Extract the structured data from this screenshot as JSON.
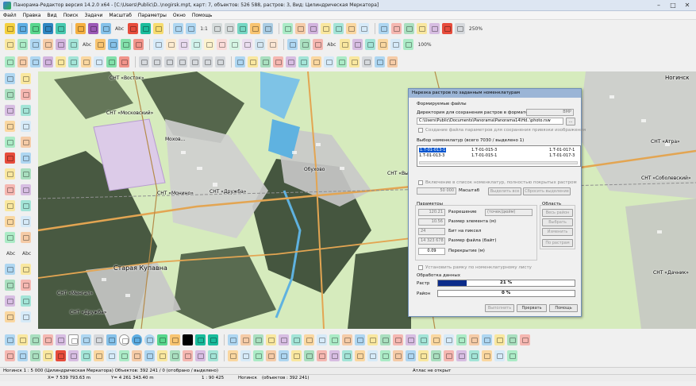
{
  "window": {
    "title": "Панорама-Редактор версия 14.2.0 x64 - [C:\\Users\\Public\\D..\\nogirsk.mpt, карт: 7, объектов: 526 588, растров: 3, Вид: Цилиндрическая Меркатора]",
    "minimize": "–",
    "maximize": "□",
    "close": "✕"
  },
  "menu": [
    "Файл",
    "Правка",
    "Вид",
    "Поиск",
    "Задачи",
    "Масштаб",
    "Параметры",
    "Окно",
    "Помощь"
  ],
  "toolbar": {
    "zoom_label": "1:1",
    "zoom_percent": "250%",
    "zoom_100": "100%",
    "abc_label": "Abc"
  },
  "map": {
    "labels": {
      "snt_vostok": "СНТ «Восток»",
      "snt_moskovskiy": "СНТ «Московский»",
      "mokhovoe": "Мохов...",
      "obukhovo": "Обухово",
      "snt_druzhba": "СНТ «Дружба»",
      "snt_monino": "СНТ «Монино»",
      "staraya_kupavna": "Старая Купавна",
      "noginsk": "Ногинск",
      "snt_mengal": "СНТ «Менгал»",
      "snt_druzhba2": "СНТ «Дружба»",
      "snt_vyserk": "СНТ «Выселки»",
      "snt_atra": "СНТ «Атра»",
      "snt_sobolevskiy": "СНТ «Соболевский»",
      "snt_dachnik": "СНТ «Дачник»"
    }
  },
  "dialog": {
    "title": "Нарезка растров по заданным номенклатурам",
    "section_form": "Формируемые файлы",
    "dir_label": "Директория для сохранения растров в формате",
    "format_value": "BMP",
    "path_value": "C:\\Users\\Public\\Documents\\Panorama\\Panorama14\\Hd..\\photo.rsw",
    "browse_btn": "...",
    "create_param_label": "Создание файла параметров для сохранения привязки изображения",
    "nom_select_label": "Выбор номенклатур (всего 7030 / выделено 1)",
    "nomenclatures": [
      [
        "1.Т-01-013-1",
        "1.Т-01-015-3",
        "1.Т-01-017-1"
      ],
      [
        "1.Т-01-013-3",
        "1.Т-01-015-1",
        "1.Т-01-017-3"
      ]
    ],
    "include_label": "Включение в список номенклатур, полностью покрытых растром",
    "scale_value": "50 000",
    "scale_label": "Масштаб",
    "select_all_btn": "Выделить все",
    "deselect_btn": "Сбросить выделение",
    "params_label": "Параметры",
    "area_label": "Область",
    "res_value": "120.21",
    "res_label": "Разрешение",
    "res_unit": "(точек/дюйм)",
    "elem_value": "10.56",
    "elem_label": "Размер элемента (м)",
    "bits_value": "24",
    "bits_label": "Бит на пиксел",
    "filesize_value": "14 323 678",
    "filesize_label": "Размер файла (байт)",
    "overlap_value": "0.09",
    "overlap_label": "Перекрытие (м)",
    "area_btn_all": "Весь район",
    "area_btn_choose": "Выбрать",
    "area_btn_change": "Изменить",
    "area_btn_raster": "По растрам",
    "frame_label": "Установить рамку по номенклатурному листу",
    "processing_label": "Обработка данных",
    "raster_label": "Растр",
    "raster_progress": 21,
    "raster_progress_text": "21 %",
    "region_label": "Район",
    "region_progress": 0,
    "region_progress_text": "0 %",
    "run_btn": "Выполнить",
    "interrupt_btn": "Прервать",
    "help_btn": "Помощь"
  },
  "status": {
    "scale_info": "Ногинск  1 : 5 000 (Цилиндрическая Меркатора)  Объектов: 392 241 / 0 (отобрано / выделено)",
    "map_scale": "1 : 90 425",
    "map_name": "Ногинск",
    "map_objects": "(объектов : 392 241)",
    "atlas": "Атлас не открыт",
    "coord_x": "X= 7 539 793.63 m",
    "coord_y": "Y= 4 261 343.40 m"
  }
}
